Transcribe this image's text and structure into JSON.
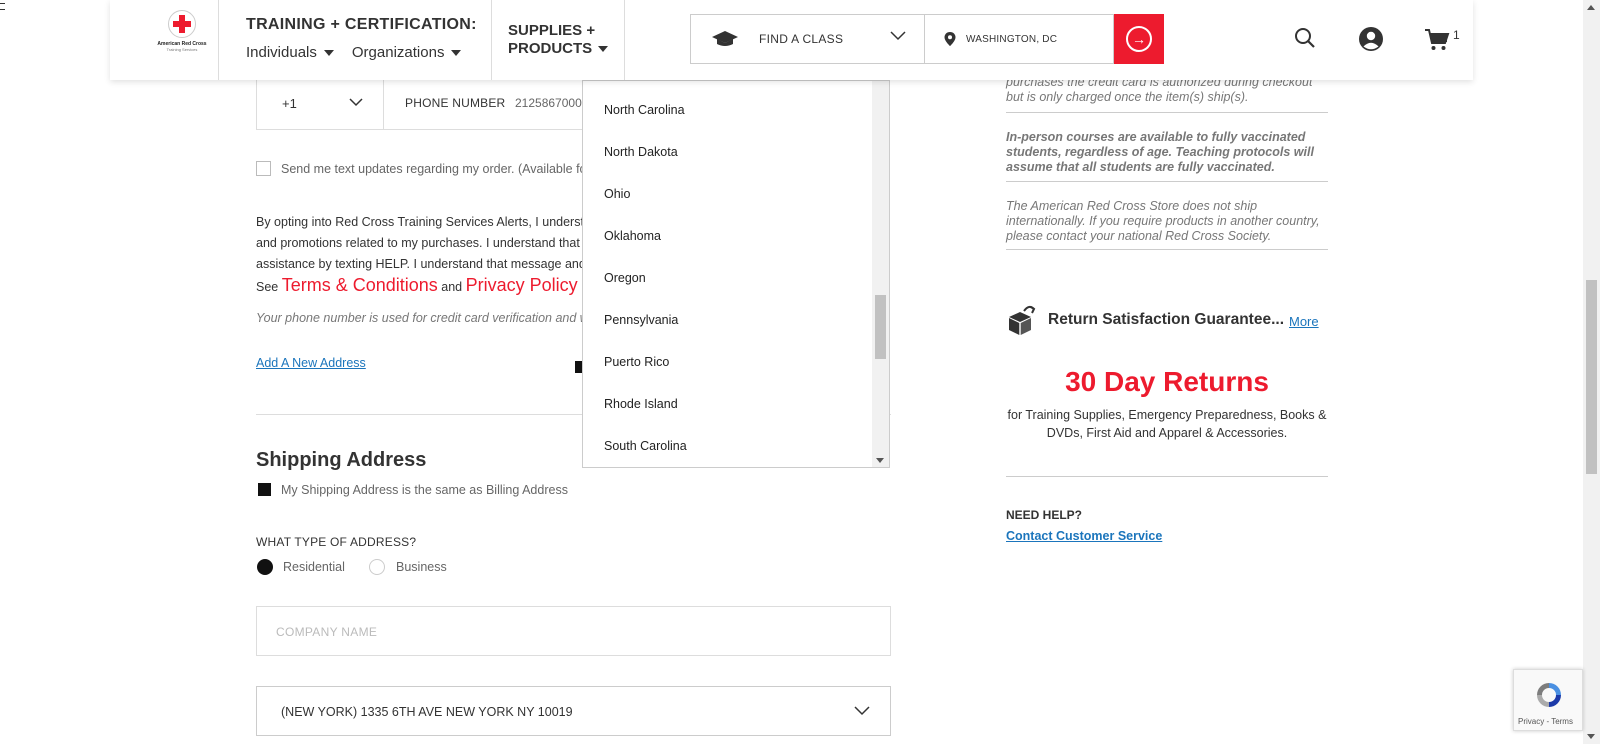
{
  "header": {
    "logo_text": "American Red Cross",
    "logo_sub": "Training Services",
    "training_title": "TRAINING + CERTIFICATION:",
    "training_links": [
      "Individuals",
      "Organizations"
    ],
    "supplies_line1": "SUPPLIES +",
    "supplies_line2": "PRODUCTS",
    "find_class": "FIND A CLASS",
    "location": "WASHINGTON, DC",
    "cart_count": "1"
  },
  "form": {
    "country_code": "+1",
    "phone_label": "PHONE NUMBER",
    "phone_value": "2125867000",
    "sms_label": "Send me text updates regarding my order. (Available for",
    "consent_lines": [
      "By opting into Red Cross Training Services Alerts, I understand",
      "and promotions related to my purchases. I understand that",
      "assistance by texting HELP. I understand that message and"
    ],
    "see_prefix": "See",
    "terms_link": "Terms & Conditions",
    "and_text": "and",
    "privacy_link": "Privacy Policy",
    "phone_note": "Your phone number is used for credit card verification and will",
    "add_address": "Add A New Address",
    "shipping_title": "Shipping Address",
    "same_as_billing": "My Shipping Address is the same as Billing Address",
    "address_type_label": "WHAT TYPE OF ADDRESS?",
    "address_types": [
      "Residential",
      "Business"
    ],
    "company_placeholder": "COMPANY NAME",
    "address_selected": "(NEW YORK) 1335 6TH AVE NEW YORK NY 10019"
  },
  "state_dropdown": {
    "options": [
      "North Carolina",
      "North Dakota",
      "Ohio",
      "Oklahoma",
      "Oregon",
      "Pennsylvania",
      "Puerto Rico",
      "Rhode Island",
      "South Carolina"
    ]
  },
  "sidebar": {
    "note_top": "purchases the credit card is authorized during checkout but is only charged once the item(s) ship(s).",
    "note_vaccine": "In-person courses are available to fully vaccinated students, regardless of age. Teaching protocols will assume that all students are fully vaccinated.",
    "note_intl": "The American Red Cross Store does not ship internationally. If you require products in another country, please contact your national Red Cross Society.",
    "guarantee_title": "Return Satisfaction Guarantee...",
    "guarantee_more": "More",
    "returns_big": "30 Day Returns",
    "returns_sub": "for Training Supplies, Emergency Preparedness, Books & DVDs, First Aid and Apparel & Accessories.",
    "need_help": "NEED HELP?",
    "contact": "Contact Customer Service"
  },
  "recaptcha": {
    "text": "Privacy - Terms"
  },
  "colors": {
    "brand_red": "#ed1b2e",
    "link_blue": "#1b75bc"
  }
}
